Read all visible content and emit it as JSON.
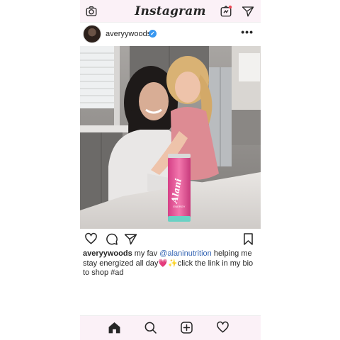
{
  "header": {
    "logo": "Instagram",
    "icons": [
      "camera-icon",
      "igtv-icon",
      "direct-message-icon"
    ],
    "notification_color": "#ed4956"
  },
  "post": {
    "username": "averyywoods",
    "verified_icon": "verified-badge-icon",
    "more_icon": "more-options-icon",
    "actions": [
      "heart-icon",
      "comment-icon",
      "share-icon",
      "bookmark-icon"
    ],
    "caption": {
      "username": "averyywoods",
      "text_before": " my fav ",
      "mention": "@alaninutrition",
      "text_after": " helping me stay energized all day💗✨click the link in my bio to shop #ad"
    },
    "can_text": "Alani",
    "can_sub": "ENERGY"
  },
  "bottom_nav": [
    "home-icon",
    "search-icon",
    "new-post-icon",
    "activity-heart-icon"
  ],
  "colors": {
    "bar_bg": "#fbf1f7",
    "mention": "#3565b4",
    "verified": "#3897f0"
  }
}
